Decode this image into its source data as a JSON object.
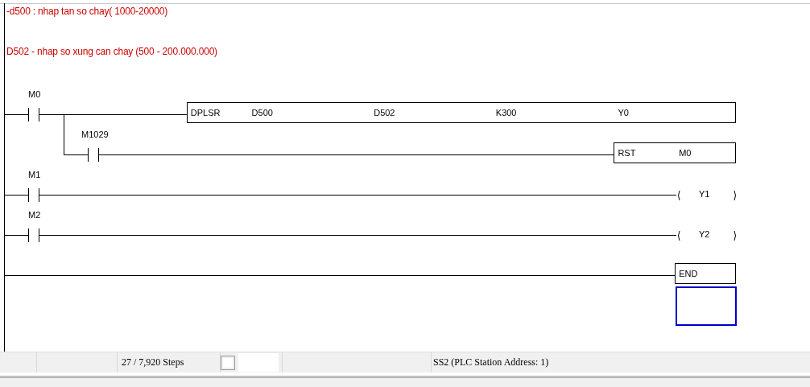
{
  "comments": [
    "-d500 : nhap tan so chay( 1000-20000)",
    "D502 - nhap so xung can chay (500 - 200.000.000)"
  ],
  "rungs": [
    {
      "contact": "M0",
      "output": {
        "kind": "box",
        "operands": [
          "DPLSR",
          "D500",
          "D502",
          "K300",
          "Y0"
        ]
      },
      "branch": {
        "contact": "M1029",
        "output": {
          "kind": "box",
          "operands": [
            "RST",
            "M0"
          ]
        }
      }
    },
    {
      "contact": "M1",
      "output": {
        "kind": "coil",
        "operand": "Y1"
      }
    },
    {
      "contact": "M2",
      "output": {
        "kind": "coil",
        "operand": "Y2"
      }
    },
    {
      "output": {
        "kind": "box",
        "operands": [
          "END"
        ]
      }
    }
  ],
  "status_bar": {
    "steps": "27 / 7,920 Steps",
    "station": "SS2 (PLC Station Address: 1)"
  }
}
